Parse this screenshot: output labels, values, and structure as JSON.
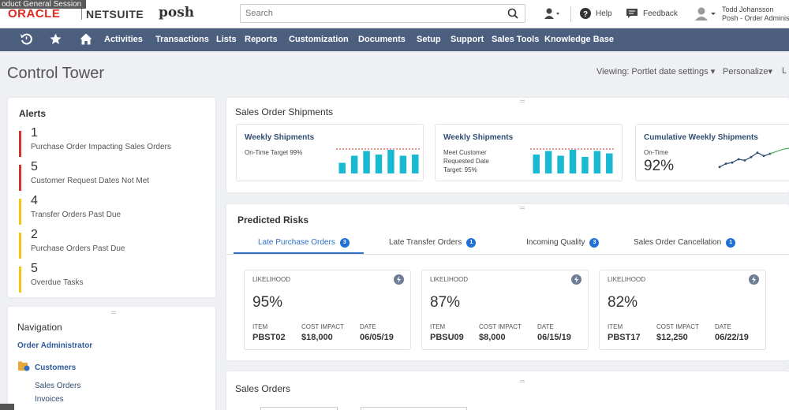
{
  "session_label": "oduct General Session",
  "header": {
    "brand_oracle": "ORACLE",
    "brand_netsuite": "NETSUITE",
    "brand_posh": "posh",
    "search_placeholder": "Search",
    "help_label": "Help",
    "feedback_label": "Feedback",
    "user_name": "Todd Johansson",
    "user_role": "Posh - Order Adminis"
  },
  "nav": {
    "items": [
      "Activities",
      "Transactions",
      "Lists",
      "Reports",
      "Customization",
      "Documents",
      "Setup",
      "Support",
      "Sales Tools",
      "Knowledge Base"
    ]
  },
  "page": {
    "title": "Control Tower",
    "viewing": "Viewing: Portlet date settings",
    "personalize": "Personalize",
    "layout_cut": "L"
  },
  "alerts": {
    "title": "Alerts",
    "items": [
      {
        "count": "1",
        "label": "Purchase Order Impacting Sales Orders",
        "color": "#d9322b"
      },
      {
        "count": "5",
        "label": "Customer Request Dates Not Met",
        "color": "#d9322b"
      },
      {
        "count": "4",
        "label": "Transfer Orders Past Due",
        "color": "#f2c511"
      },
      {
        "count": "2",
        "label": "Purchase Orders Past Due",
        "color": "#f2c511"
      },
      {
        "count": "5",
        "label": "Overdue Tasks",
        "color": "#f2c511"
      }
    ]
  },
  "navigation": {
    "title": "Navigation",
    "role": "Order Administrator",
    "section": "Customers",
    "links": [
      "Sales Orders",
      "Invoices"
    ]
  },
  "shipments": {
    "title": "Sales Order Shipments",
    "cards": [
      {
        "title": "Weekly Shipments",
        "desc": [
          "On-Time Target 99%"
        ]
      },
      {
        "title": "Weekly Shipments",
        "desc": [
          "Meet Customer",
          "Requested Date",
          "Target: 95%"
        ]
      },
      {
        "title": "Cumulative Weekly Shipments",
        "desc": [
          "On-Time"
        ],
        "value": "92%"
      }
    ]
  },
  "risks": {
    "title": "Predicted Risks",
    "tabs": [
      {
        "label": "Late Purchase Orders",
        "badge": "3"
      },
      {
        "label": "Late Transfer Orders",
        "badge": "1"
      },
      {
        "label": "Incoming Quality",
        "badge": "3"
      },
      {
        "label": "Sales Order Cancellation",
        "badge": "1"
      }
    ],
    "col_labels": {
      "likelihood": "LIKELIHOOD",
      "item": "ITEM",
      "cost": "COST IMPACT",
      "date": "DATE"
    },
    "cards": [
      {
        "likelihood": "95%",
        "item": "PBST02",
        "cost": "$18,000",
        "date": "06/05/19"
      },
      {
        "likelihood": "87%",
        "item": "PBSU09",
        "cost": "$8,000",
        "date": "06/15/19"
      },
      {
        "likelihood": "82%",
        "item": "PBST17",
        "cost": "$12,250",
        "date": "06/22/19"
      }
    ]
  },
  "sales_orders": {
    "title": "Sales Orders"
  },
  "colors": {
    "nav_bg": "#4d5f7f",
    "bar": "#19b9d2",
    "accent": "#2f6fc4",
    "target_line": "#d9322b",
    "trend_line": "#2f4c70"
  },
  "chart_data": [
    {
      "type": "bar",
      "title": "Weekly Shipments",
      "values": [
        0.45,
        0.75,
        0.95,
        0.8,
        1.0,
        0.75,
        0.8
      ],
      "target": 1.0
    },
    {
      "type": "bar",
      "title": "Weekly Shipments",
      "values": [
        0.8,
        0.95,
        0.75,
        1.0,
        0.7,
        0.95,
        0.85
      ],
      "target": 1.0
    },
    {
      "type": "line",
      "title": "Cumulative Weekly Shipments",
      "values": [
        0.15,
        0.3,
        0.35,
        0.5,
        0.45,
        0.6,
        0.8,
        0.65,
        0.75
      ],
      "overlay": [
        0.85,
        0.95,
        1.0
      ]
    }
  ]
}
